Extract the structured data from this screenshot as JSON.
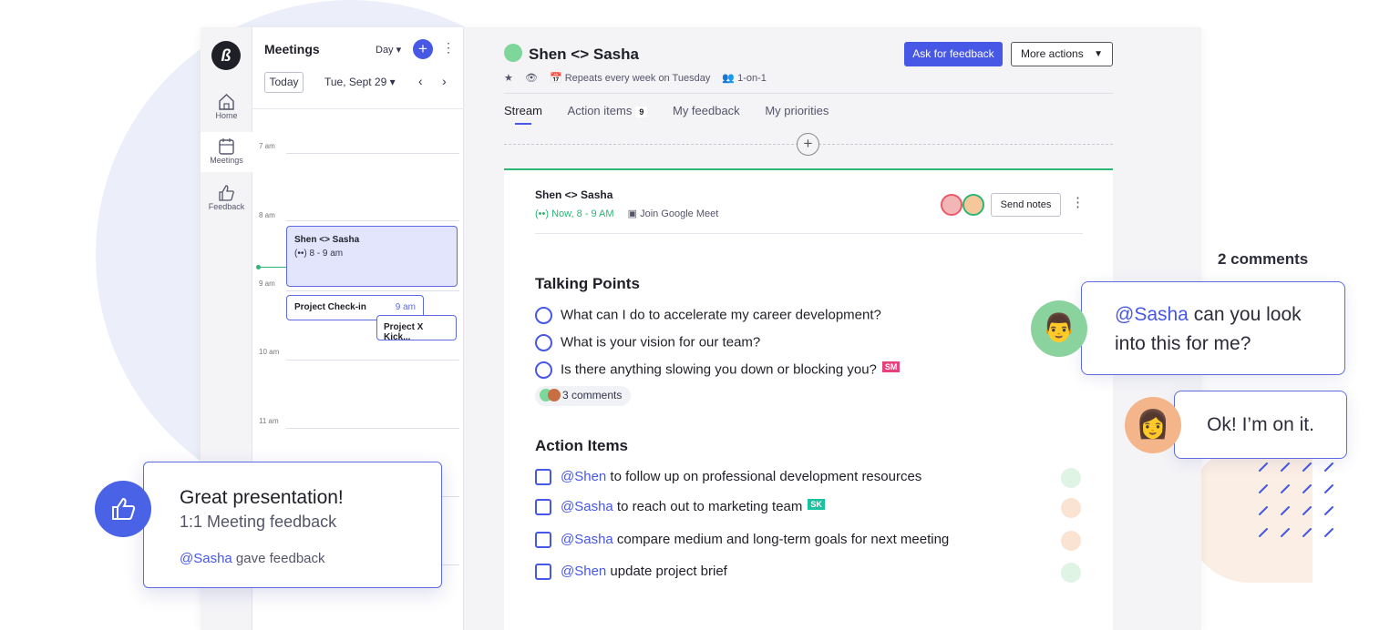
{
  "rail": {
    "logo": "ß",
    "items": [
      {
        "label": "Home",
        "icon": "home-icon"
      },
      {
        "label": "Meetings",
        "icon": "calendar-icon"
      },
      {
        "label": "Feedback",
        "icon": "thumbs-up-icon"
      }
    ]
  },
  "calendar": {
    "title": "Meetings",
    "view_select": "Day ▾",
    "add": "+",
    "today": "Today",
    "date": "Tue, Sept 29 ▾",
    "prev": "‹",
    "next": "›",
    "hours": [
      "7 am",
      "8 am",
      "9 am",
      "10 am",
      "11 am"
    ],
    "events": [
      {
        "title": "Shen <> Sasha",
        "time": "(••) 8 - 9 am"
      },
      {
        "title": "Project Check-in",
        "time": "9 am"
      },
      {
        "title": "Project X Kick..."
      }
    ]
  },
  "header": {
    "title": "Shen <> Sasha",
    "meta": [
      "★",
      "👁",
      "📅 Repeats every week on Tuesday",
      "👥 1-on-1"
    ],
    "ask_feedback": "Ask for feedback",
    "more_actions": "More actions",
    "tabs": [
      {
        "label": "Stream",
        "active": true
      },
      {
        "label": "Action items",
        "badge": "9"
      },
      {
        "label": "My feedback"
      },
      {
        "label": "My priorities"
      }
    ],
    "add": "+"
  },
  "note": {
    "title": "Shen <> Sasha",
    "now": "(••) Now, 8 - 9 AM",
    "meet": "▣ Join Google Meet",
    "send_notes": "Send notes",
    "talking_points_title": "Talking Points",
    "talking_points": [
      {
        "text": "What can I do to accelerate my career development?"
      },
      {
        "text": "What is your vision for our team?"
      },
      {
        "text": "Is there anything slowing you down or blocking you?",
        "tag": "SM"
      }
    ],
    "comments": "3 comments",
    "action_items_title": "Action Items",
    "action_items": [
      {
        "mention": "@Shen",
        "text": " to follow up on professional development resources",
        "assignee_color": "#dff4e4"
      },
      {
        "mention": "@Sasha",
        "text": " to reach out to marketing team",
        "tag": "SK",
        "assignee_color": "#fbe3d4"
      },
      {
        "mention": "@Sasha",
        "text": " compare medium and long-term goals for next meeting",
        "assignee_color": "#fbe3d4"
      },
      {
        "mention": "@Shen",
        "text": " update project brief",
        "assignee_color": "#dff4e4"
      }
    ]
  },
  "feedback_card": {
    "title": "Great presentation!",
    "subtitle": "1:1 Meeting feedback",
    "mention": "@Sasha",
    "by": " gave feedback"
  },
  "comments_panel": {
    "count": "2 comments",
    "first_mention": "@Sasha",
    "first_text": " can you look into this for me?",
    "reply": "Ok! I’m on it."
  },
  "colors": {
    "accent": "#4757e6",
    "live": "#2bb673",
    "tag_sm": "#e8407c",
    "tag_sk": "#19c3a0"
  }
}
